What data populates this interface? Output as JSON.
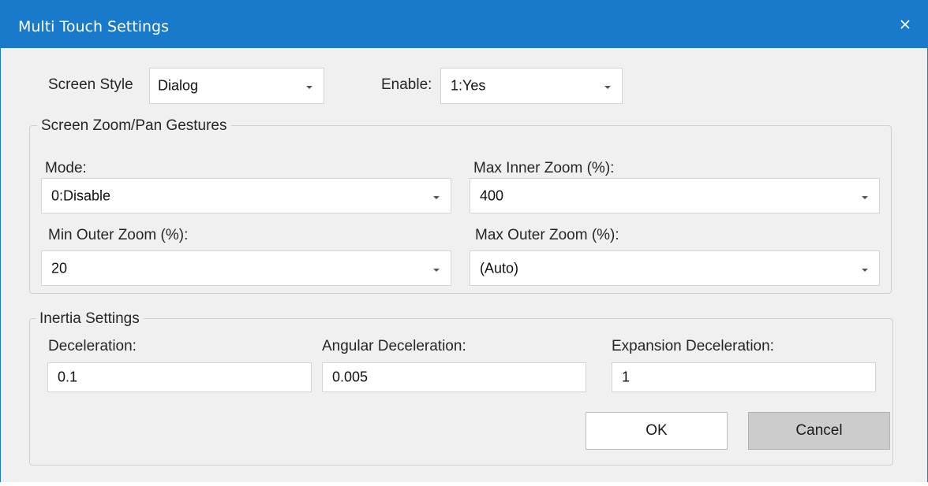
{
  "window": {
    "title": "Multi Touch Settings"
  },
  "top": {
    "screen_style": {
      "label": "Screen Style",
      "value": "Dialog"
    },
    "enable": {
      "label": "Enable:",
      "value": "1:Yes"
    }
  },
  "zoom_group": {
    "title": "Screen Zoom/Pan Gestures",
    "mode": {
      "label": "Mode:",
      "value": "0:Disable"
    },
    "max_inner": {
      "label": "Max Inner Zoom (%):",
      "value": "400"
    },
    "min_outer": {
      "label": "Min Outer Zoom (%):",
      "value": "20"
    },
    "max_outer": {
      "label": "Max Outer Zoom (%):",
      "value": "(Auto)"
    }
  },
  "inertia_group": {
    "title": "Inertia Settings",
    "deceleration": {
      "label": "Deceleration:",
      "value": "0.1"
    },
    "angular": {
      "label": "Angular Deceleration:",
      "value": "0.005"
    },
    "expansion": {
      "label": "Expansion Deceleration:",
      "value": "1"
    }
  },
  "buttons": {
    "ok": "OK",
    "cancel": "Cancel"
  },
  "icons": {
    "close": "close-icon",
    "dropdown": "chevron-down-icon"
  },
  "colors": {
    "titlebar": "#1979ca",
    "dialog_bg": "#f0f0f0"
  }
}
